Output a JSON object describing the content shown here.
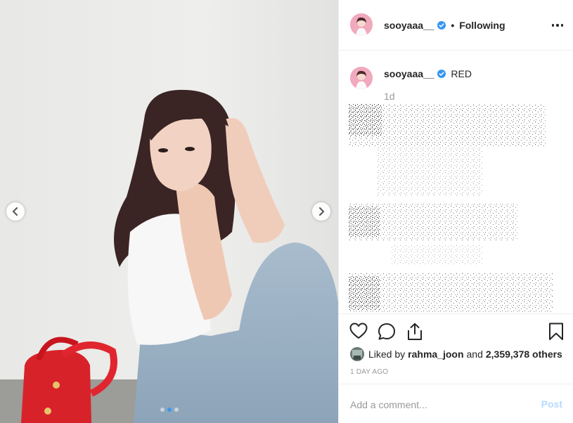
{
  "author": {
    "username": "sooyaaa__",
    "verified": true,
    "follow_status": "Following"
  },
  "caption": {
    "username": "sooyaaa__",
    "text": "RED",
    "age": "1d"
  },
  "likes": {
    "prefix": "Liked by",
    "liker": "rahma_joon",
    "connector": "and",
    "others": "2,359,378 others"
  },
  "post_date": "1 DAY AGO",
  "comment": {
    "placeholder": "Add a comment...",
    "value": "",
    "post_label": "Post"
  },
  "carousel": {
    "slide_count": 3,
    "active_slide": 2
  },
  "icons": {
    "prev": "chevron-left-icon",
    "next": "chevron-right-icon",
    "more": "more-options-icon",
    "like": "heart-icon",
    "comment": "comment-icon",
    "share": "share-icon",
    "save": "bookmark-icon",
    "verified": "verified-badge-icon"
  },
  "colors": {
    "accent": "#3897f0",
    "post_button_disabled": "#b3dbff",
    "text": "#262626",
    "muted": "#999999",
    "divider": "#efefef"
  }
}
